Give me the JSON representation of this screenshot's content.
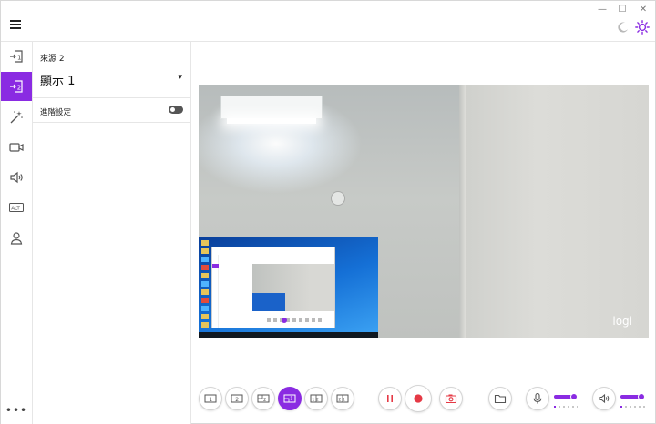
{
  "window": {
    "minimize_glyph": "—",
    "maximize_glyph": "☐",
    "close_glyph": "✕"
  },
  "theme": {
    "dark_mode_icon": "moon-icon",
    "light_mode_icon": "sun-icon",
    "accent": "#8a2be2"
  },
  "rail": {
    "items": [
      {
        "name": "source-1",
        "icon": "source-1-icon",
        "label": "1",
        "active": false
      },
      {
        "name": "source-2",
        "icon": "source-2-icon",
        "label": "2",
        "active": true
      },
      {
        "name": "effects",
        "icon": "magic-wand-icon",
        "active": false
      },
      {
        "name": "camera",
        "icon": "camera-icon",
        "active": false
      },
      {
        "name": "audio",
        "icon": "speaker-icon",
        "active": false
      },
      {
        "name": "alt",
        "icon": "alt-icon",
        "label": "ALT",
        "active": false
      },
      {
        "name": "account",
        "icon": "person-icon",
        "active": false
      }
    ],
    "more_label": "•••"
  },
  "panel": {
    "source_label": "來源 2",
    "display_value": "顯示 1",
    "advanced_label": "進階設定",
    "advanced_enabled": false
  },
  "preview": {
    "watermark": "logi"
  },
  "toolbar": {
    "layouts": [
      {
        "name": "layout-single-1",
        "label": "1",
        "active": false
      },
      {
        "name": "layout-single-2",
        "label": "2",
        "active": false
      },
      {
        "name": "layout-pip-2-in-1",
        "label": "2",
        "active": false
      },
      {
        "name": "layout-pip-1-in-2",
        "label": "1",
        "active": true
      },
      {
        "name": "layout-side-by-side-12",
        "label": "12",
        "active": false
      },
      {
        "name": "layout-side-by-side-21",
        "label": "21",
        "active": false
      }
    ],
    "mic_level": 0.85,
    "speaker_level": 0.85
  }
}
